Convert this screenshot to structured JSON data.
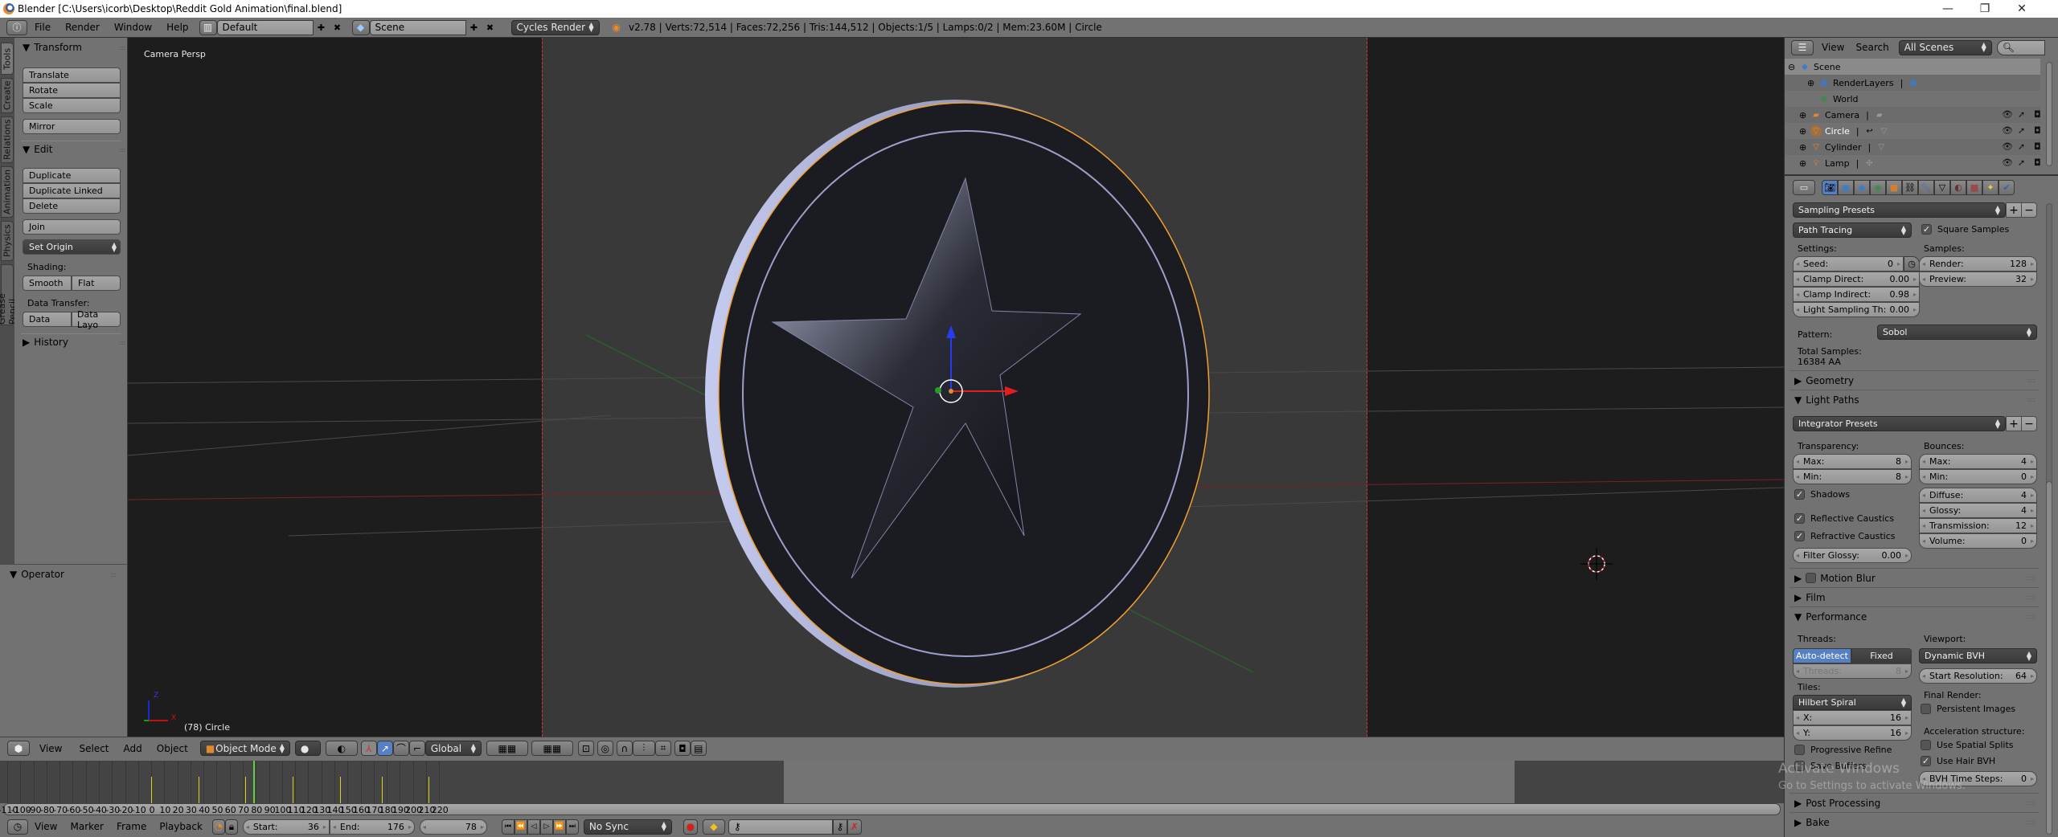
{
  "window": {
    "title": "Blender [C:\\Users\\icorb\\Desktop\\Reddit Gold Animation\\final.blend]",
    "controls": [
      "minimize",
      "restore",
      "close"
    ]
  },
  "info_header": {
    "menus": [
      "File",
      "Render",
      "Window",
      "Help"
    ],
    "screen_layout": "Default",
    "scene": "Scene",
    "render_engine": "Cycles Render",
    "stats": "v2.78 | Verts:72,514 | Faces:72,256 | Tris:144,512 | Objects:1/5 | Lamps:0/2 | Mem:23.60M | Circle"
  },
  "tool_tabs": [
    "Tools",
    "Create",
    "Relations",
    "Animation",
    "Physics",
    "Grease Pencil"
  ],
  "tool_shelf": {
    "transform": {
      "title": "Transform",
      "buttons": [
        "Translate",
        "Rotate",
        "Scale"
      ],
      "mirror": "Mirror"
    },
    "edit": {
      "title": "Edit",
      "buttons": [
        "Duplicate",
        "Duplicate Linked",
        "Delete"
      ],
      "join": "Join",
      "set_origin": "Set Origin",
      "shading_label": "Shading:",
      "shading": [
        "Smooth",
        "Flat"
      ],
      "data_transfer_label": "Data Transfer:",
      "data_transfer": [
        "Data",
        "Data Layo"
      ]
    },
    "history": "History",
    "operator": "Operator"
  },
  "viewport": {
    "view_label": "Camera Persp",
    "object_label": "(78) Circle",
    "axis_labels": {
      "x": "X",
      "y": "Y",
      "z": "Z"
    }
  },
  "view3d_header": {
    "menus": [
      "View",
      "Select",
      "Add",
      "Object"
    ],
    "mode": "Object Mode",
    "orientation": "Global"
  },
  "timeline": {
    "ticks": [
      -110,
      -100,
      -90,
      -80,
      -70,
      -60,
      -50,
      -40,
      -30,
      -20,
      -10,
      0,
      10,
      20,
      30,
      40,
      50,
      60,
      70,
      80,
      90,
      100,
      110,
      120,
      130,
      140,
      150,
      160,
      170,
      180,
      190,
      200,
      210,
      220
    ],
    "current_frame_marker": 78,
    "keyframes": [
      0,
      36,
      72,
      108,
      144,
      176,
      212
    ],
    "menus": [
      "View",
      "Marker",
      "Frame",
      "Playback"
    ],
    "start_label": "Start:",
    "start": "36",
    "end_label": "End:",
    "end": "176",
    "current_frame": "78",
    "sync": "No Sync"
  },
  "outliner": {
    "menus": [
      "View",
      "Search"
    ],
    "filter": "All Scenes",
    "items": [
      {
        "name": "Scene",
        "icon": "scene-icon"
      },
      {
        "name": "RenderLayers",
        "icon": "renderlayers-icon"
      },
      {
        "name": "World",
        "icon": "world-icon"
      },
      {
        "name": "Camera",
        "icon": "camera-icon"
      },
      {
        "name": "Circle",
        "icon": "mesh-icon"
      },
      {
        "name": "Cylinder",
        "icon": "mesh-icon"
      },
      {
        "name": "Lamp",
        "icon": "lamp-icon"
      }
    ]
  },
  "properties": {
    "tabs": [
      "render",
      "render-layers",
      "scene",
      "world",
      "object",
      "constraints",
      "modifiers",
      "data",
      "material",
      "texture",
      "particles",
      "physics"
    ],
    "sampling": {
      "presets": "Sampling Presets",
      "integrator": "Path Tracing",
      "square_samples": "Square Samples",
      "settings_label": "Settings:",
      "seed": {
        "label": "Seed:",
        "value": "0"
      },
      "clamp_direct": {
        "label": "Clamp Direct:",
        "value": "0.00"
      },
      "clamp_indirect": {
        "label": "Clamp Indirect:",
        "value": "0.98"
      },
      "light_sampling": {
        "label": "Light Sampling Th:",
        "value": "0.00"
      },
      "samples_label": "Samples:",
      "render": {
        "label": "Render:",
        "value": "128"
      },
      "preview": {
        "label": "Preview:",
        "value": "32"
      },
      "pattern_label": "Pattern:",
      "pattern": "Sobol",
      "total_label": "Total Samples:",
      "total": "16384 AA"
    },
    "geometry": "Geometry",
    "light_paths": {
      "title": "Light Paths",
      "presets": "Integrator Presets",
      "transparency_label": "Transparency:",
      "t_max": {
        "label": "Max:",
        "value": "8"
      },
      "t_min": {
        "label": "Min:",
        "value": "8"
      },
      "shadows": "Shadows",
      "reflective": "Reflective Caustics",
      "refractive": "Refractive Caustics",
      "filter_glossy": {
        "label": "Filter Glossy:",
        "value": "0.00"
      },
      "bounces_label": "Bounces:",
      "b_max": {
        "label": "Max:",
        "value": "4"
      },
      "b_min": {
        "label": "Min:",
        "value": "0"
      },
      "diffuse": {
        "label": "Diffuse:",
        "value": "4"
      },
      "glossy": {
        "label": "Glossy:",
        "value": "4"
      },
      "transmission": {
        "label": "Transmission:",
        "value": "12"
      },
      "volume": {
        "label": "Volume:",
        "value": "0"
      }
    },
    "motion_blur": "Motion Blur",
    "film": "Film",
    "performance": {
      "title": "Performance",
      "threads_label": "Threads:",
      "auto_detect": "Auto-detect",
      "fixed": "Fixed",
      "threads": {
        "label": "Threads:",
        "value": "8"
      },
      "tiles_label": "Tiles:",
      "tile_order": "Hilbert Spiral",
      "x": {
        "label": "X:",
        "value": "16"
      },
      "y": {
        "label": "Y:",
        "value": "16"
      },
      "progressive_refine": "Progressive Refine",
      "save_buffers": "Save Buffers",
      "viewport_label": "Viewport:",
      "viewport_bvh": "Dynamic BVH",
      "start_resolution": {
        "label": "Start Resolution:",
        "value": "64"
      },
      "final_render_label": "Final Render:",
      "persistent_images": "Persistent Images",
      "accel_label": "Acceleration structure:",
      "spatial_splits": "Use Spatial Splits",
      "hair_bvh": "Use Hair BVH",
      "bvh_time_steps": {
        "label": "BVH Time Steps:",
        "value": "0"
      }
    },
    "post_processing": "Post Processing",
    "bake": "Bake"
  },
  "watermark": {
    "line1": "Activate Windows",
    "line2": "Go to Settings to activate Windows."
  },
  "colors": {
    "selection_orange": "#f0a030",
    "active_blue": "#5680c2",
    "header_gray": "#727272"
  }
}
